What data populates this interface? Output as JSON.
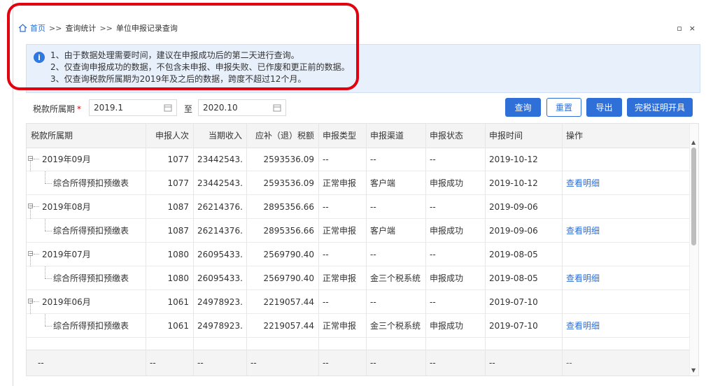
{
  "breadcrumb": {
    "home": "首页",
    "sep": ">>",
    "level1": "查询统计",
    "level2": "单位申报记录查询"
  },
  "window": {
    "restore": "▫",
    "close": "×"
  },
  "notice": {
    "lines": [
      "1、由于数据处理需要时间，建议在申报成功后的第二天进行查询。",
      "2、仅查询申报成功的数据，不包含未申报、申报失败、已作废和更正前的数据。",
      "3、仅查询税款所属期为2019年及之后的数据，跨度不超过12个月。"
    ]
  },
  "filter": {
    "label": "税款所属期",
    "required": "*",
    "start": "2019.1",
    "to": "至",
    "end": "2020.10"
  },
  "buttons": {
    "query": "查询",
    "reset": "重置",
    "export": "导出",
    "certificate": "完税证明开具"
  },
  "table": {
    "headers": [
      "税款所属期",
      "申报人次",
      "当期收入",
      "应补（退）税额",
      "申报类型",
      "申报渠道",
      "申报状态",
      "申报时间",
      "操作"
    ],
    "rows": [
      {
        "period": "2019年09月",
        "count": "1077",
        "income": "23442543....",
        "tax": "2593536.09",
        "type": "--",
        "channel": "--",
        "status": "--",
        "time": "2019-10-12",
        "op": ""
      },
      {
        "period": "综合所得预扣预缴表",
        "count": "1077",
        "income": "23442543....",
        "tax": "2593536.09",
        "type": "正常申报",
        "channel": "客户端",
        "status": "申报成功",
        "time": "2019-10-12",
        "op": "查看明细"
      },
      {
        "period": "2019年08月",
        "count": "1087",
        "income": "26214376....",
        "tax": "2895356.66",
        "type": "--",
        "channel": "--",
        "status": "--",
        "time": "2019-09-06",
        "op": ""
      },
      {
        "period": "综合所得预扣预缴表",
        "count": "1087",
        "income": "26214376....",
        "tax": "2895356.66",
        "type": "正常申报",
        "channel": "客户端",
        "status": "申报成功",
        "time": "2019-09-06",
        "op": "查看明细"
      },
      {
        "period": "2019年07月",
        "count": "1080",
        "income": "26095433....",
        "tax": "2569790.40",
        "type": "--",
        "channel": "--",
        "status": "--",
        "time": "2019-08-05",
        "op": ""
      },
      {
        "period": "综合所得预扣预缴表",
        "count": "1080",
        "income": "26095433....",
        "tax": "2569790.40",
        "type": "正常申报",
        "channel": "金三个税系统",
        "status": "申报成功",
        "time": "2019-08-05",
        "op": "查看明细"
      },
      {
        "period": "2019年06月",
        "count": "1061",
        "income": "24978923....",
        "tax": "2219057.44",
        "type": "--",
        "channel": "--",
        "status": "--",
        "time": "2019-07-10",
        "op": ""
      },
      {
        "period": "综合所得预扣预缴表",
        "count": "1061",
        "income": "24978923....",
        "tax": "2219057.44",
        "type": "正常申报",
        "channel": "金三个税系统",
        "status": "申报成功",
        "time": "2019-07-10",
        "op": "查看明细"
      }
    ],
    "footer": [
      "--",
      "--",
      "--",
      "--",
      "--",
      "--",
      "--",
      "--",
      "--"
    ]
  }
}
